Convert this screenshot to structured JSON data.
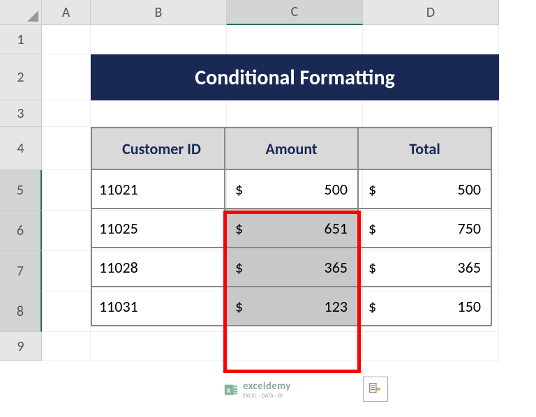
{
  "columns": [
    "A",
    "B",
    "C",
    "D"
  ],
  "rows": [
    "1",
    "2",
    "3",
    "4",
    "5",
    "6",
    "7",
    "8",
    "9"
  ],
  "active_column": "C",
  "selected_rows": [
    "5",
    "6",
    "7",
    "8"
  ],
  "title": "Conditional Formatting",
  "table": {
    "headers": {
      "id": "Customer ID",
      "amount": "Amount",
      "total": "Total"
    },
    "rows": [
      {
        "id": "11021",
        "amount": "500",
        "total": "500",
        "shaded": false
      },
      {
        "id": "11025",
        "amount": "651",
        "total": "750",
        "shaded": true
      },
      {
        "id": "11028",
        "amount": "365",
        "total": "365",
        "shaded": true
      },
      {
        "id": "11031",
        "amount": "123",
        "total": "150",
        "shaded": true
      }
    ],
    "currency": "$"
  },
  "watermark": {
    "main": "exceldemy",
    "sub": "EXCEL · DATA · BI"
  },
  "chart_data": {
    "type": "table",
    "title": "Conditional Formatting",
    "columns": [
      "Customer ID",
      "Amount",
      "Total"
    ],
    "rows": [
      [
        "11021",
        500,
        500
      ],
      [
        "11025",
        651,
        750
      ],
      [
        "11028",
        365,
        365
      ],
      [
        "11031",
        123,
        150
      ]
    ],
    "currency": "USD",
    "highlighted_column": "Amount",
    "shaded_cells": [
      [
        1,
        1
      ],
      [
        2,
        1
      ],
      [
        3,
        1
      ]
    ]
  }
}
